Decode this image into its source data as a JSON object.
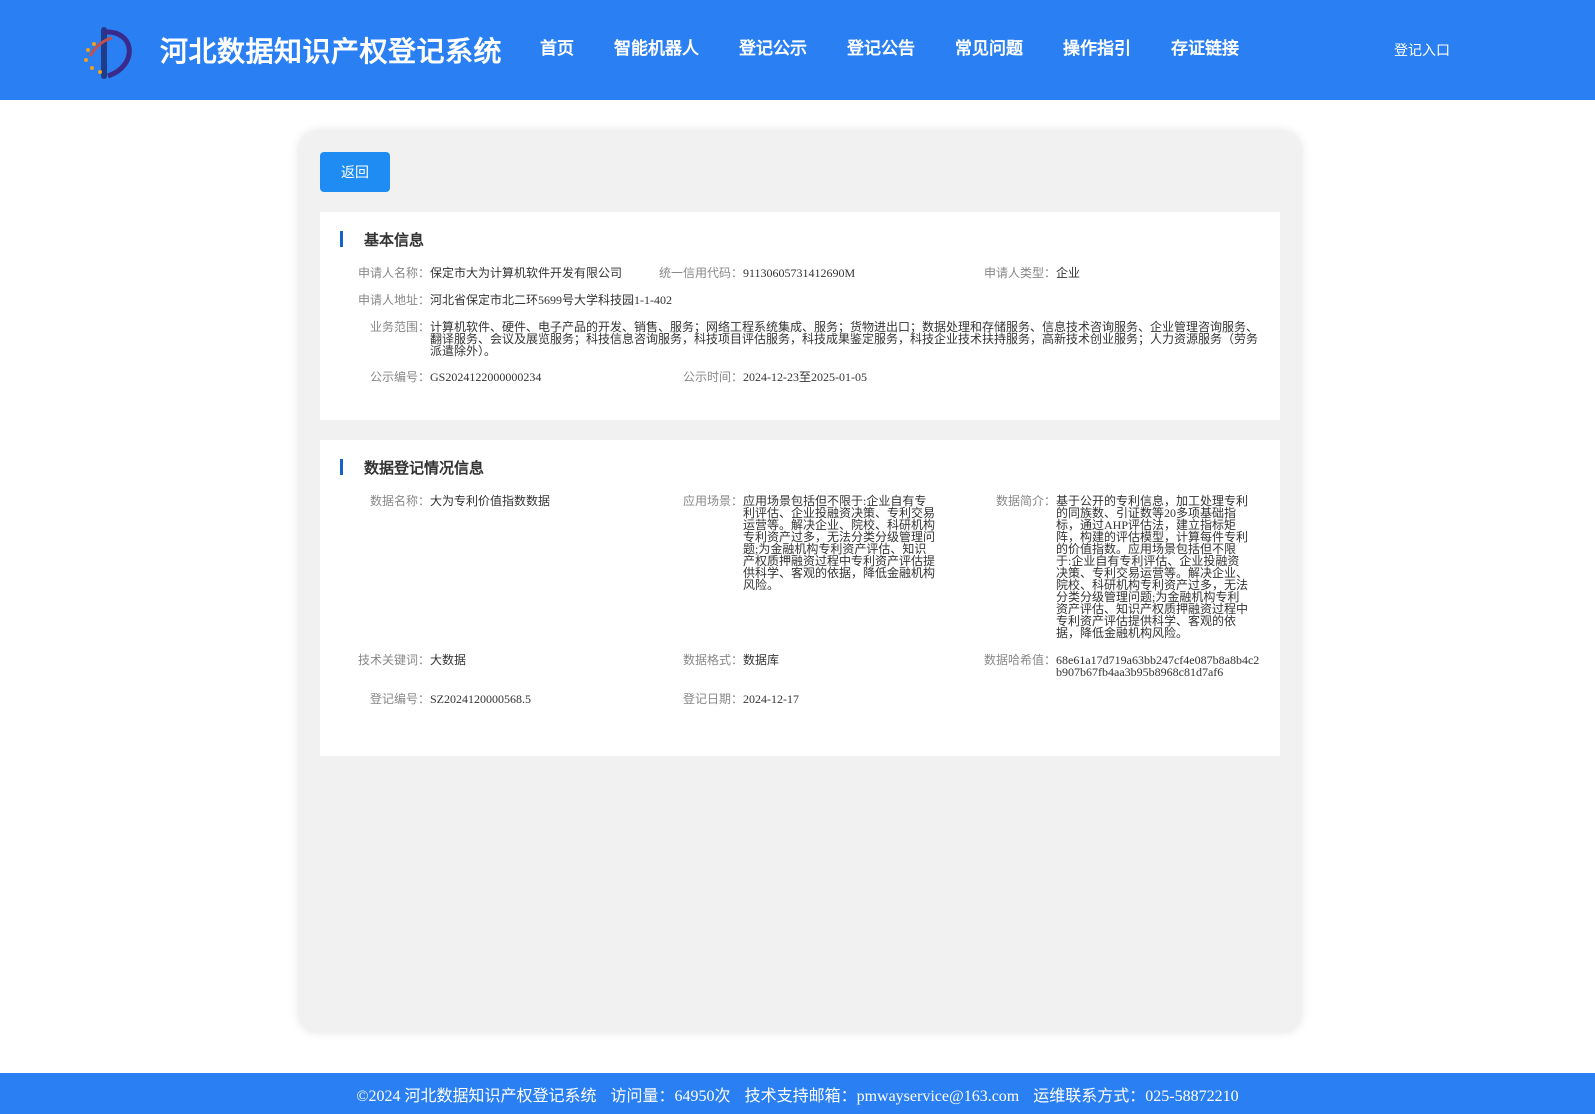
{
  "header": {
    "site_title": "河北数据知识产权登记系统",
    "nav": [
      "首页",
      "智能机器人",
      "登记公示",
      "登记公告",
      "常见问题",
      "操作指引",
      "存证链接"
    ],
    "login": "登记入口"
  },
  "back_button": "返回",
  "basic": {
    "title": "基本信息",
    "applicant_name_label": "申请人名称：",
    "applicant_name": "保定市大为计算机软件开发有限公司",
    "credit_code_label": "统一信用代码：",
    "credit_code": "91130605731412690M",
    "applicant_type_label": "申请人类型：",
    "applicant_type": "企业",
    "address_label": "申请人地址：",
    "address": "河北省保定市北二环5699号大学科技园1-1-402",
    "scope_label": "业务范围：",
    "scope": "计算机软件、硬件、电子产品的开发、销售、服务；网络工程系统集成、服务；货物进出口；数据处理和存储服务、信息技术咨询服务、企业管理咨询服务、翻译服务、会议及展览服务；科技信息咨询服务，科技项目评估服务，科技成果鉴定服务，科技企业技术扶持服务，高新技术创业服务；人力资源服务（劳务派遣除外）。",
    "notice_no_label": "公示编号：",
    "notice_no": "GS2024122000000234",
    "notice_time_label": "公示时间：",
    "notice_time": "2024-12-23至2025-01-05"
  },
  "data_info": {
    "title": "数据登记情况信息",
    "data_name_label": "数据名称：",
    "data_name": "大为专利价值指数数据",
    "scenario_label": "应用场景：",
    "scenario": "应用场景包括但不限于:企业自有专利评估、企业投融资决策、专利交易运营等。解决企业、院校、科研机构专利资产过多，无法分类分级管理问题;为金融机构专利资产评估、知识产权质押融资过程中专利资产评估提供科学、客观的依据，降低金融机构风险。",
    "intro_label": "数据简介：",
    "intro": "基于公开的专利信息，加工处理专利的同族数、引证数等20多项基础指标，通过AHP评估法，建立指标矩阵，构建的评估模型，计算每件专利的价值指数。应用场景包括但不限于:企业自有专利评估、企业投融资决策、专利交易运营等。解决企业、院校、科研机构专利资产过多，无法分类分级管理问题;为金融机构专利资产评估、知识产权质押融资过程中专利资产评估提供科学、客观的依据，降低金融机构风险。",
    "keywords_label": "技术关键词：",
    "keywords": "大数据",
    "format_label": "数据格式：",
    "format": "数据库",
    "hash_label": "数据哈希值：",
    "hash": "68e61a17d719a63bb247cf4e087b8a8b4c2b907b67fb4aa3b95b8968c81d7af6",
    "reg_no_label": "登记编号：",
    "reg_no": "SZ2024120000568.5",
    "reg_date_label": "登记日期：",
    "reg_date": "2024-12-17"
  },
  "footer": {
    "copyright": "©2024 河北数据知识产权登记系统",
    "visits": "访问量：64950次",
    "email": "技术支持邮箱：pmwayservice@163.com",
    "phone": "运维联系方式：025-58872210"
  }
}
